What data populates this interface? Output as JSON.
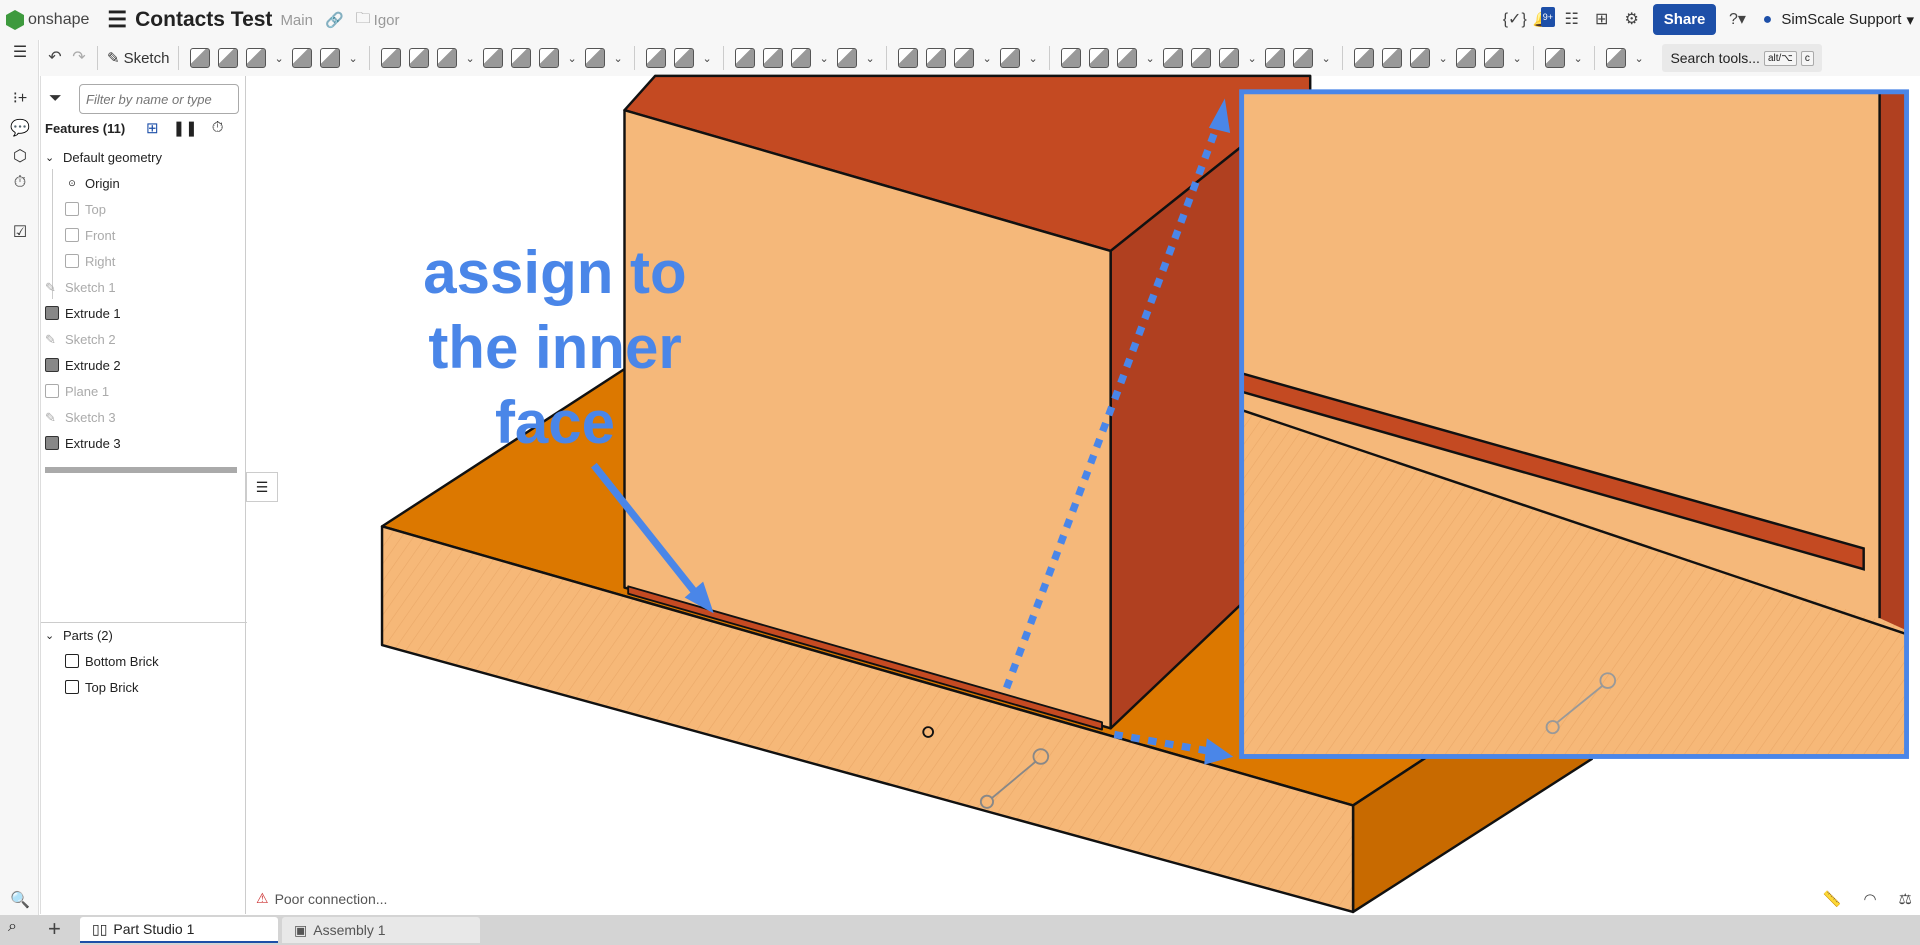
{
  "header": {
    "logo": "onshape",
    "title": "Contacts Test",
    "branch": "Main",
    "folder": "Igor",
    "notifications": "9+",
    "share": "Share",
    "user": "SimScale Support"
  },
  "toolbar": {
    "sketch": "Sketch",
    "search": "Search tools...",
    "kbd1": "alt/⌥",
    "kbd2": "c",
    "groups": [
      [
        "extrude",
        "revolve",
        "sweep",
        "loft",
        "thicken"
      ],
      [
        "fillet",
        "chamfer",
        "draft",
        "rib",
        "shell",
        "hole",
        "thread"
      ],
      [
        "pattern",
        "mirror"
      ],
      [
        "boolean",
        "split",
        "transform",
        "delete-part"
      ],
      [
        "modify-fillet",
        "delete-face",
        "move-face",
        "replace-face"
      ],
      [
        "plane",
        "helix-surface",
        "helix",
        "mate-connector",
        "insert-part",
        "variable",
        "derived",
        "tag"
      ],
      [
        "sheet-metal",
        "sheet-metal-flange",
        "sheet-metal-tab",
        "sheet-metal-corner",
        "sheet-metal-table"
      ],
      [
        "frame"
      ],
      [
        "featurescript"
      ]
    ]
  },
  "panel": {
    "filter_placeholder": "Filter by name or type",
    "features_title": "Features (11)",
    "default_geometry": "Default geometry",
    "items": [
      "Origin",
      "Top",
      "Front",
      "Right",
      "Sketch 1",
      "Extrude 1",
      "Sketch 2",
      "Extrude 2",
      "Plane 1",
      "Sketch 3",
      "Extrude 3"
    ],
    "parts_title": "Parts (2)",
    "parts": [
      "Bottom Brick",
      "Top Brick"
    ]
  },
  "annotation": {
    "line1": "assign to",
    "line2": "the inner",
    "line3": "face",
    "color": "#4a86e8"
  },
  "status": "Poor connection...",
  "tabs": [
    "Part Studio 1",
    "Assembly 1"
  ],
  "colors": {
    "brand": "#1d4fa8",
    "light_face": "#f5b87a",
    "top_face": "#c44a22",
    "side_face": "#b04020",
    "base_top": "#dc7800"
  }
}
